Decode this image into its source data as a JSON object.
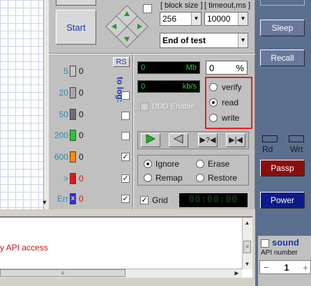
{
  "toolbar": {
    "start_label": "Start",
    "block_size_label": "[ block size ]",
    "block_size_value": "256",
    "timeout_label": "[ timeout,ms ]",
    "timeout_value": "10000",
    "end_action_value": "End of test"
  },
  "counters": {
    "rs_label": "RS",
    "to_log_label": "to log:",
    "rows": [
      {
        "label": "5",
        "value": "0",
        "color": "#c8c8c8",
        "logged": false
      },
      {
        "label": "20",
        "value": "0",
        "color": "#a8a8a8",
        "logged": false
      },
      {
        "label": "50",
        "value": "0",
        "color": "#6f6f6f",
        "logged": false
      },
      {
        "label": "200",
        "value": "0",
        "color": "#22cc22",
        "logged": false
      },
      {
        "label": "600",
        "value": "0",
        "color": "#ff8c00",
        "logged": true
      },
      {
        "label": ">",
        "value": "0",
        "color": "#e81414",
        "logged": true
      },
      {
        "label": "Err",
        "value": "0",
        "color": "#2a2aff",
        "logged": true
      }
    ]
  },
  "meters": {
    "mb_value": "0",
    "mb_unit": "Mb",
    "percent_value": "0",
    "percent_unit": "%",
    "kbs_value": "0",
    "kbs_unit": "kb/s",
    "ddd_label": "DDD Enable"
  },
  "mode": {
    "options": [
      "verify",
      "read",
      "write"
    ],
    "selected": "read"
  },
  "error_handling": {
    "ignore": "Ignore",
    "erase": "Erase",
    "remap": "Remap",
    "restore": "Restore",
    "selected": "Ignore"
  },
  "grid": {
    "label": "Grid",
    "checked": true,
    "timer": "00:00:00"
  },
  "sidebar": {
    "sleep": "Sleep",
    "recall": "Recall",
    "rd": "Rd",
    "wrt": "Wrt",
    "passp": "Passp",
    "power": "Power",
    "sound_label": "sound",
    "api_label": "API number",
    "api_value": "1",
    "api_minus": "−",
    "api_plus": "+"
  },
  "log": {
    "line": "y API access"
  },
  "colors": {
    "accent_blue": "#1a3aa8",
    "highlight_red": "#e02020",
    "sidebar_bg": "#5b6f8f"
  }
}
